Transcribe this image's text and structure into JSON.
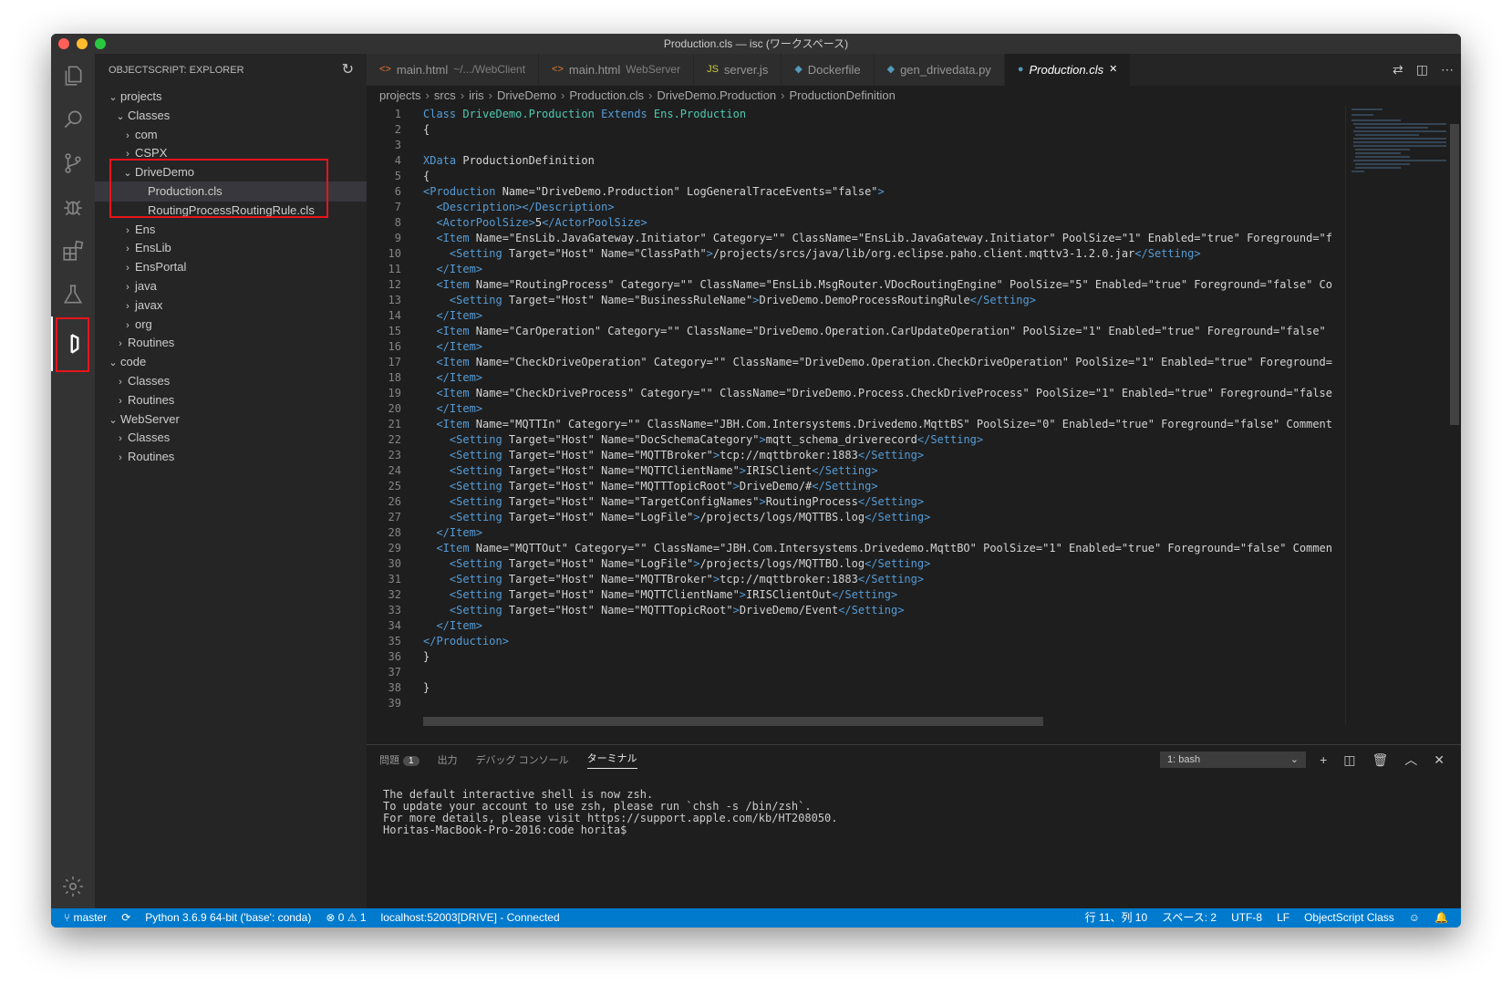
{
  "window": {
    "title": "Production.cls — isc (ワークスペース)"
  },
  "sidebar": {
    "title": "OBJECTSCRIPT: EXPLORER",
    "tree": [
      {
        "label": "projects",
        "depth": 0,
        "expanded": true
      },
      {
        "label": "Classes",
        "depth": 1,
        "expanded": true
      },
      {
        "label": "com",
        "depth": 2,
        "expanded": false
      },
      {
        "label": "CSPX",
        "depth": 2,
        "expanded": false
      },
      {
        "label": "DriveDemo",
        "depth": 2,
        "expanded": true
      },
      {
        "label": "Production.cls",
        "depth": 3,
        "file": true,
        "selected": true
      },
      {
        "label": "RoutingProcessRoutingRule.cls",
        "depth": 3,
        "file": true
      },
      {
        "label": "Ens",
        "depth": 2,
        "expanded": false
      },
      {
        "label": "EnsLib",
        "depth": 2,
        "expanded": false
      },
      {
        "label": "EnsPortal",
        "depth": 2,
        "expanded": false
      },
      {
        "label": "java",
        "depth": 2,
        "expanded": false
      },
      {
        "label": "javax",
        "depth": 2,
        "expanded": false
      },
      {
        "label": "org",
        "depth": 2,
        "expanded": false
      },
      {
        "label": "Routines",
        "depth": 1,
        "expanded": false
      },
      {
        "label": "code",
        "depth": 0,
        "expanded": true
      },
      {
        "label": "Classes",
        "depth": 1,
        "expanded": false
      },
      {
        "label": "Routines",
        "depth": 1,
        "expanded": false
      },
      {
        "label": "WebServer",
        "depth": 0,
        "expanded": true
      },
      {
        "label": "Classes",
        "depth": 1,
        "expanded": false
      },
      {
        "label": "Routines",
        "depth": 1,
        "expanded": false
      }
    ]
  },
  "tabs": [
    {
      "icon": "<>",
      "label": "main.html",
      "sub": "~/.../WebClient",
      "icon_color": "#e37933"
    },
    {
      "icon": "<>",
      "label": "main.html",
      "sub": "WebServer",
      "icon_color": "#e37933"
    },
    {
      "icon": "JS",
      "label": "server.js",
      "sub": "",
      "icon_color": "#cbcb41"
    },
    {
      "icon": "◆",
      "label": "Dockerfile",
      "sub": "",
      "icon_color": "#519aba"
    },
    {
      "icon": "◆",
      "label": "gen_drivedata.py",
      "sub": "",
      "icon_color": "#519aba"
    },
    {
      "icon": "●",
      "label": "Production.cls",
      "sub": "",
      "icon_color": "#519aba",
      "active": true
    }
  ],
  "breadcrumb": [
    "projects",
    "srcs",
    "iris",
    "DriveDemo",
    "Production.cls",
    "DriveDemo.Production",
    "ProductionDefinition"
  ],
  "code_lines": [
    "Class DriveDemo.Production Extends Ens.Production",
    "{",
    "",
    "XData ProductionDefinition",
    "{",
    "<Production Name=\"DriveDemo.Production\" LogGeneralTraceEvents=\"false\">",
    "  <Description></Description>",
    "  <ActorPoolSize>5</ActorPoolSize>",
    "  <Item Name=\"EnsLib.JavaGateway.Initiator\" Category=\"\" ClassName=\"EnsLib.JavaGateway.Initiator\" PoolSize=\"1\" Enabled=\"true\" Foreground=\"f",
    "    <Setting Target=\"Host\" Name=\"ClassPath\">/projects/srcs/java/lib/org.eclipse.paho.client.mqttv3-1.2.0.jar</Setting>",
    "  </Item>",
    "  <Item Name=\"RoutingProcess\" Category=\"\" ClassName=\"EnsLib.MsgRouter.VDocRoutingEngine\" PoolSize=\"5\" Enabled=\"true\" Foreground=\"false\" Co",
    "    <Setting Target=\"Host\" Name=\"BusinessRuleName\">DriveDemo.DemoProcessRoutingRule</Setting>",
    "  </Item>",
    "  <Item Name=\"CarOperation\" Category=\"\" ClassName=\"DriveDemo.Operation.CarUpdateOperation\" PoolSize=\"1\" Enabled=\"true\" Foreground=\"false\"",
    "  </Item>",
    "  <Item Name=\"CheckDriveOperation\" Category=\"\" ClassName=\"DriveDemo.Operation.CheckDriveOperation\" PoolSize=\"1\" Enabled=\"true\" Foreground=",
    "  </Item>",
    "  <Item Name=\"CheckDriveProcess\" Category=\"\" ClassName=\"DriveDemo.Process.CheckDriveProcess\" PoolSize=\"1\" Enabled=\"true\" Foreground=\"false",
    "  </Item>",
    "  <Item Name=\"MQTTIn\" Category=\"\" ClassName=\"JBH.Com.Intersystems.Drivedemo.MqttBS\" PoolSize=\"0\" Enabled=\"true\" Foreground=\"false\" Comment",
    "    <Setting Target=\"Host\" Name=\"DocSchemaCategory\">mqtt_schema_driverecord</Setting>",
    "    <Setting Target=\"Host\" Name=\"MQTTBroker\">tcp://mqttbroker:1883</Setting>",
    "    <Setting Target=\"Host\" Name=\"MQTTClientName\">IRISClient</Setting>",
    "    <Setting Target=\"Host\" Name=\"MQTTTopicRoot\">DriveDemo/#</Setting>",
    "    <Setting Target=\"Host\" Name=\"TargetConfigNames\">RoutingProcess</Setting>",
    "    <Setting Target=\"Host\" Name=\"LogFile\">/projects/logs/MQTTBS.log</Setting>",
    "  </Item>",
    "  <Item Name=\"MQTTOut\" Category=\"\" ClassName=\"JBH.Com.Intersystems.Drivedemo.MqttBO\" PoolSize=\"1\" Enabled=\"true\" Foreground=\"false\" Commen",
    "    <Setting Target=\"Host\" Name=\"LogFile\">/projects/logs/MQTTBO.log</Setting>",
    "    <Setting Target=\"Host\" Name=\"MQTTBroker\">tcp://mqttbroker:1883</Setting>",
    "    <Setting Target=\"Host\" Name=\"MQTTClientName\">IRISClientOut</Setting>",
    "    <Setting Target=\"Host\" Name=\"MQTTTopicRoot\">DriveDemo/Event</Setting>",
    "  </Item>",
    "</Production>",
    "}",
    "",
    "}",
    ""
  ],
  "panel": {
    "tabs": [
      {
        "label": "問題",
        "badge": "1"
      },
      {
        "label": "出力"
      },
      {
        "label": "デバッグ コンソール"
      },
      {
        "label": "ターミナル",
        "active": true
      }
    ],
    "terminal_select": "1: bash",
    "terminal_lines": [
      "The default interactive shell is now zsh.",
      "To update your account to use zsh, please run `chsh -s /bin/zsh`.",
      "For more details, please visit https://support.apple.com/kb/HT208050.",
      "Horitas-MacBook-Pro-2016:code horita$ "
    ]
  },
  "status": {
    "branch": "master",
    "python": "Python 3.6.9 64-bit ('base': conda)",
    "errors": "0",
    "warnings": "1",
    "connection": "localhost:52003[DRIVE] - Connected",
    "position": "行 11、列 10",
    "spaces": "スペース: 2",
    "encoding": "UTF-8",
    "eol": "LF",
    "language": "ObjectScript Class"
  },
  "colors": {
    "accent": "#007acc",
    "highlight_box": "#e8141b"
  }
}
